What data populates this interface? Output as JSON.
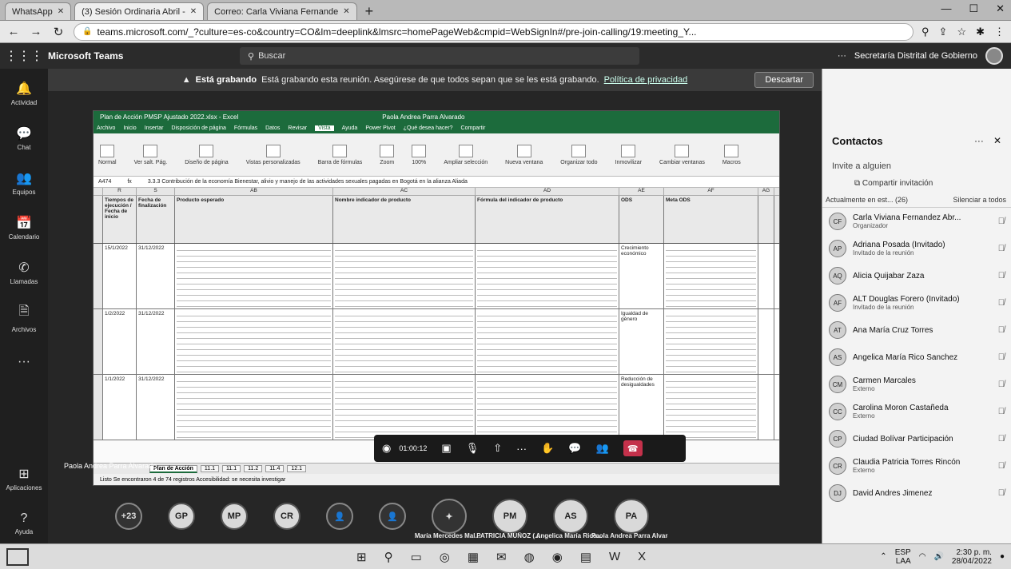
{
  "browser": {
    "tabs": [
      {
        "label": "WhatsApp"
      },
      {
        "label": "(3) Sesión Ordinaria Abril -"
      },
      {
        "label": "Correo: Carla Viviana Fernande"
      }
    ],
    "url": "teams.microsoft.com/_?culture=es-co&country=CO&lm=deeplink&lmsrc=homePageWeb&cmpid=WebSignIn#/pre-join-calling/19:meeting_Y..."
  },
  "teams": {
    "app_name": "Microsoft Teams",
    "search_placeholder": "Buscar",
    "org_name": "Secretaría Distrital de Gobierno",
    "recording_bold": "Está grabando",
    "recording_text": "Está grabando esta reunión. Asegúrese de que todos sepan que se les está grabando.",
    "privacy_link": "Política de privacidad",
    "dismiss_label": "Descartar",
    "rail": [
      {
        "label": "Actividad",
        "icon": "bell-icon"
      },
      {
        "label": "Chat",
        "icon": "chat-icon"
      },
      {
        "label": "Equipos",
        "icon": "teams-icon"
      },
      {
        "label": "Calendario",
        "icon": "calendar-icon"
      },
      {
        "label": "Llamadas",
        "icon": "phone-icon"
      },
      {
        "label": "Archivos",
        "icon": "file-icon"
      },
      {
        "label": "Aplicaciones",
        "icon": "apps-icon"
      },
      {
        "label": "Ayuda",
        "icon": "help-icon"
      }
    ]
  },
  "excel": {
    "title": "Plan de Acción PMSP Ajustado 2022.xlsx - Excel",
    "user": "Paola Andrea Parra Alvarado",
    "menu": [
      "Archivo",
      "Inicio",
      "Insertar",
      "Disposición de página",
      "Fórmulas",
      "Datos",
      "Revisar",
      "Vista",
      "Ayuda",
      "Power Pivot",
      "¿Qué desea hacer?",
      "Compartir"
    ],
    "active_menu": "Vista",
    "ribbon": [
      "Normal",
      "Ver salt. Pág.",
      "Diseño de página",
      "Vistas personalizadas",
      "Barra de fórmulas",
      "Zoom",
      "100%",
      "Ampliar selección",
      "Nueva ventana",
      "Organizar todo",
      "Inmovilizar",
      "Cambiar ventanas",
      "Macros"
    ],
    "cell_ref": "A474",
    "formula": "3.3.3 Contribución de la economía Bienestar, alivio y manejo de las actividades sexuales pagadas en Bogotá en la alianza Aliada",
    "columns": [
      "R",
      "S",
      "AB",
      "AC",
      "AD",
      "AE",
      "AF",
      "AG"
    ],
    "headers": [
      "Tiempos de ejecución / Fecha de inicio",
      "Fecha de finalización",
      "Producto esperado",
      "Nombre indicador de producto",
      "Fórmula del indicador de producto",
      "ODS",
      "Meta ODS",
      ""
    ],
    "rows": [
      {
        "start": "15/1/2022",
        "end": "31/12/2022",
        "ods": "Crecimiento económico"
      },
      {
        "start": "1/2/2022",
        "end": "31/12/2022",
        "ods": "Igualdad de género"
      },
      {
        "start": "1/1/2022",
        "end": "31/12/2022",
        "ods": "Reducción de desigualdades"
      }
    ],
    "sheet_tabs": [
      "Plan de Acción",
      "11.1",
      "11.1",
      "11.2",
      "11.4",
      "12.1"
    ],
    "active_sheet": "Plan de Acción",
    "status": "Listo   Se encontraron 4 de 74 registros   Accesibilidad: se necesita investigar",
    "presenter": "Paola Andrea Parra Alvarado"
  },
  "call": {
    "timer": "01:00:12",
    "participants": [
      {
        "initials": "+23",
        "name": ""
      },
      {
        "initials": "GP",
        "name": ""
      },
      {
        "initials": "MP",
        "name": ""
      },
      {
        "initials": "CR",
        "name": ""
      },
      {
        "initials": "",
        "name": ""
      },
      {
        "initials": "",
        "name": ""
      },
      {
        "initials": "",
        "name": "María Mercedes Mal..."
      },
      {
        "initials": "PM",
        "name": "PATRICIA MUÑOZ (..."
      },
      {
        "initials": "AS",
        "name": "Angelica María Rico..."
      },
      {
        "initials": "PA",
        "name": "Paola Andrea Parra Alvarad..."
      }
    ]
  },
  "contacts": {
    "title": "Contactos",
    "invite": "Invite a alguien",
    "share": "Compartir invitación",
    "in_meeting": "Actualmente en est... (26)",
    "mute_all": "Silenciar a todos",
    "people": [
      {
        "initials": "CF",
        "name": "Carla Viviana Fernandez Abr...",
        "role": "Organizador"
      },
      {
        "initials": "AP",
        "name": "Adriana Posada (Invitado)",
        "role": "Invitado de la reunión"
      },
      {
        "initials": "AQ",
        "name": "Alicia Quijabar Zaza",
        "role": ""
      },
      {
        "initials": "AF",
        "name": "ALT Douglas Forero (Invitado)",
        "role": "Invitado de la reunión"
      },
      {
        "initials": "AT",
        "name": "Ana María Cruz Torres",
        "role": ""
      },
      {
        "initials": "AS",
        "name": "Angelica María Rico Sanchez",
        "role": ""
      },
      {
        "initials": "CM",
        "name": "Carmen Marcales",
        "role": "Externo"
      },
      {
        "initials": "CC",
        "name": "Carolina Moron Castañeda",
        "role": "Externo"
      },
      {
        "initials": "CP",
        "name": "Ciudad Bolívar Participación",
        "role": ""
      },
      {
        "initials": "CR",
        "name": "Claudia Patricia Torres Rincón",
        "role": "Externo"
      },
      {
        "initials": "DJ",
        "name": "David Andres Jimenez",
        "role": ""
      }
    ]
  },
  "taskbar": {
    "lang": "ESP",
    "lang2": "LAA",
    "time": "2:30 p. m.",
    "date": "28/04/2022"
  }
}
